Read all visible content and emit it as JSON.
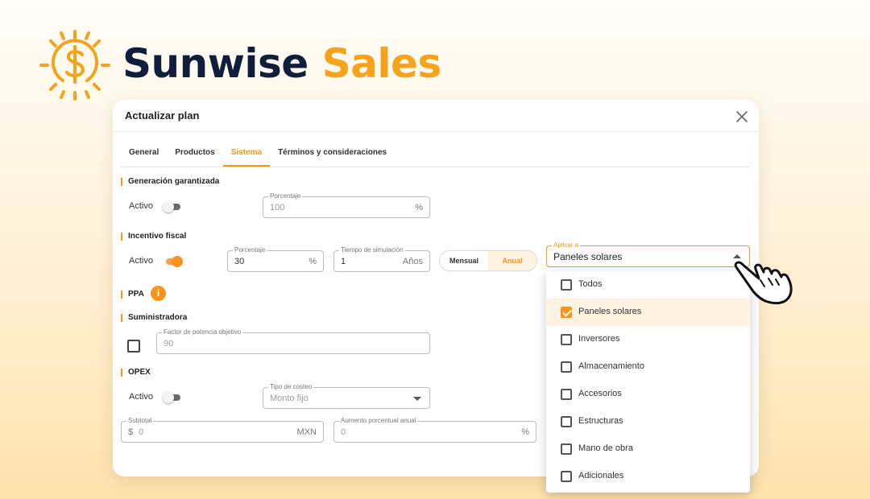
{
  "brand": {
    "name_part1": "Sunwise",
    "name_part2": "Sales"
  },
  "modal": {
    "title": "Actualizar plan",
    "tabs": [
      {
        "label": "General",
        "active": false
      },
      {
        "label": "Productos",
        "active": false
      },
      {
        "label": "Sistema",
        "active": true
      },
      {
        "label": "Términos y consideraciones",
        "active": false
      }
    ]
  },
  "sections": {
    "generacion": {
      "title": "Generación garantizada",
      "activo_label": "Activo",
      "activo_on": false,
      "porcentaje": {
        "label": "Porcentaje",
        "value": "100",
        "suffix": "%"
      }
    },
    "incentivo": {
      "title": "Incentivo fiscal",
      "activo_label": "Activo",
      "activo_on": true,
      "porcentaje": {
        "label": "Porcentaje",
        "value": "30",
        "suffix": "%"
      },
      "tiempo": {
        "label": "Tiempo de simulación",
        "value": "1",
        "suffix": "Años"
      },
      "periodo": {
        "options": [
          "Mensual",
          "Anual"
        ],
        "selected": "Anual"
      },
      "aplicar": {
        "label": "Aplicar a",
        "value": "Paneles solares",
        "options": [
          {
            "label": "Todos",
            "checked": false
          },
          {
            "label": "Paneles solares",
            "checked": true
          },
          {
            "label": "Inversores",
            "checked": false
          },
          {
            "label": "Almacenamiento",
            "checked": false
          },
          {
            "label": "Accesorios",
            "checked": false
          },
          {
            "label": "Estructuras",
            "checked": false
          },
          {
            "label": "Mano de obra",
            "checked": false
          },
          {
            "label": "Adicionales",
            "checked": false
          }
        ]
      }
    },
    "ppa": {
      "title": "PPA",
      "info_icon": "i"
    },
    "suministradora": {
      "title": "Suministradora",
      "checked": false,
      "factor": {
        "label": "Factor de potencia objetivo",
        "value": "90"
      }
    },
    "opex": {
      "title": "OPEX",
      "activo_label": "Activo",
      "activo_on": false,
      "tipo_costeo": {
        "label": "Tipo de costeo",
        "value": "Monto fijo"
      },
      "subtotal": {
        "label": "Subtotal",
        "prefix": "$",
        "value": "0",
        "suffix": "MXN"
      },
      "aumento": {
        "label": "Aumento porcentual anual",
        "value": "0",
        "suffix": "%"
      }
    }
  },
  "icons": {
    "logo": "sun-dollar-icon",
    "close": "close-icon",
    "cursor": "hand-pointer-icon"
  },
  "colors": {
    "accent": "#f7941d",
    "brand_dark": "#0f1e3a",
    "brand_accent": "#f7a21b"
  }
}
